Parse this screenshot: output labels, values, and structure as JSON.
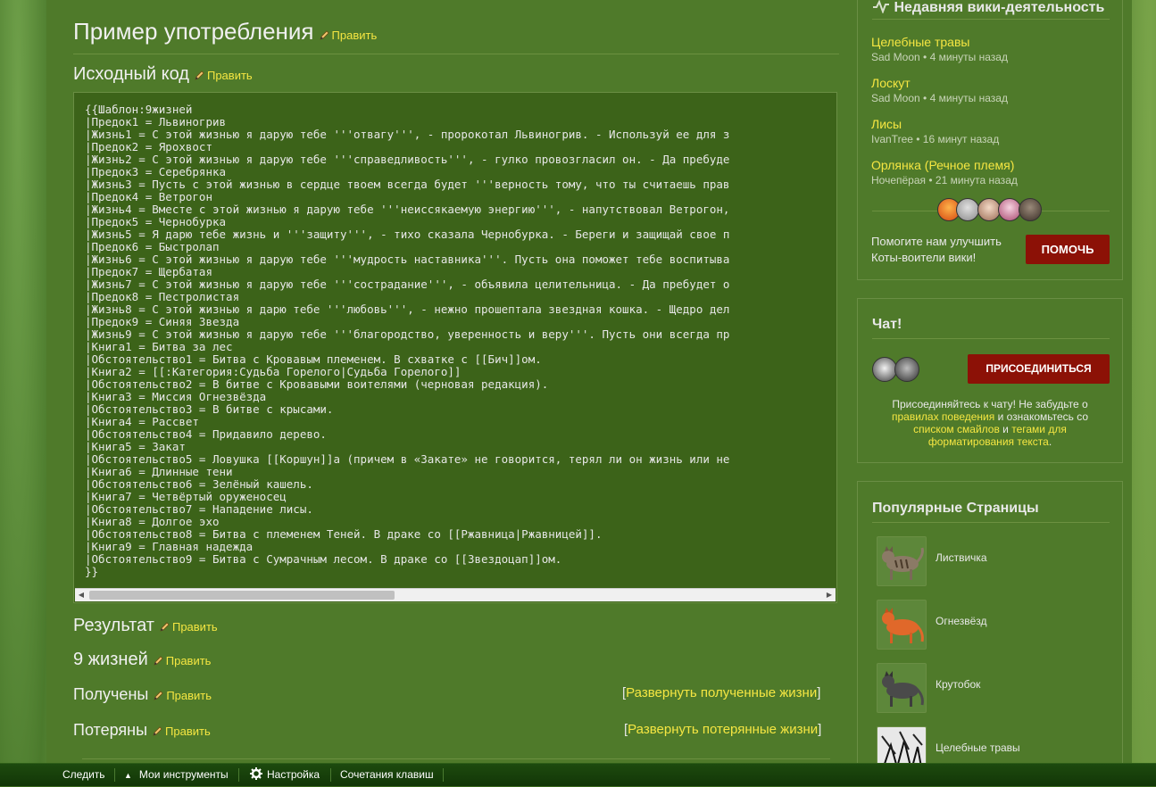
{
  "edit_label": "Править",
  "sections": {
    "usage_heading": "Пример употребления",
    "source_heading": "Исходный код",
    "result_heading": "Результат",
    "lives_heading": "9 жизней",
    "received_heading": "Получены",
    "lost_heading": "Потеряны"
  },
  "expand": {
    "received": "Развернуть полученные жизни",
    "lost": "Развернуть потерянные жизни",
    "bracket_open": "[",
    "bracket_close": "]"
  },
  "code_lines": [
    "{{Шаблон:9жизней",
    "|Предок1 = Львиногрив",
    "|Жизнь1 = С этой жизнью я дарую тебе '''отвагу''', - пророкотал Львиногрив. - Используй ее для з",
    "|Предок2 = Ярохвост",
    "|Жизнь2 = С этой жизнью я дарую тебе '''справедливость''', - гулко провозгласил он. - Да пребуде",
    "|Предок3 = Серебрянка",
    "|Жизнь3 = Пусть с этой жизнью в сердце твоем всегда будет '''верность тому, что ты считаешь прав",
    "|Предок4 = Ветрогон",
    "|Жизнь4 = Вместе с этой жизнью я дарую тебе '''неиссякаемую энергию''', - напутствовал Ветрогон,",
    "|Предок5 = Чернобурка",
    "|Жизнь5 = Я дарю тебе жизнь и '''защиту''', - тихо сказала Чернобурка. - Береги и защищай свое п",
    "|Предок6 = Быстролап",
    "|Жизнь6 = С этой жизнью я дарую тебе '''мудрость наставника'''. Пусть она поможет тебе воспитыва",
    "|Предок7 = Щербатая",
    "|Жизнь7 = С этой жизнью я дарую тебе '''сострадание''', - объявила целительница. - Да пребудет о",
    "|Предок8 = Пестролистая",
    "|Жизнь8 = С этой жизнью я дарю тебе '''любовь''', - нежно прошептала звездная кошка. - Щедро дел",
    "|Предок9 = Синяя Звезда",
    "|Жизнь9 = С этой жизнью я дарую тебе '''благородство, уверенность и веру'''. Пусть они всегда пр",
    "|Книга1 = Битва за лес",
    "|Обстоятельство1 = Битва с Кровавым племенем. В схватке с [[Бич]]ом.",
    "|Книга2 = [[:Категория:Судьба Горелого|Судьба Горелого]]",
    "|Обстоятельство2 = В битве с Кровавыми воителями (черновая редакция).",
    "|Книга3 = Миссия Огнезвёзда",
    "|Обстоятельство3 = В битве с крысами.",
    "|Книга4 = Рассвет",
    "|Обстоятельство4 = Придавило дерево.",
    "|Книга5 = Закат",
    "|Обстоятельство5 = Ловушка [[Коршун]]а (причем в «Закате» не говорится, терял ли он жизнь или не",
    "|Книга6 = Длинные тени",
    "|Обстоятельство6 = Зелёный кашель.",
    "|Книга7 = Четвёртый оруженосец",
    "|Обстоятельство7 = Нападение лисы.",
    "|Книга8 = Долгое эхо",
    "|Обстоятельство8 = Битва с племенем Теней. В драке со [[Ржавница|Ржавницей]].",
    "|Книга9 = Главная надежда",
    "|Обстоятельство9 = Битва с Сумрачным лесом. В драке со [[Звездоцап]]ом.",
    "}}"
  ],
  "activity": {
    "title": "Недавняя вики-деятельность",
    "items": [
      {
        "page": "Целебные травы",
        "meta": "Sad Moon • 4 минуты назад"
      },
      {
        "page": "Лоскут",
        "meta": "Sad Moon • 4 минуты назад"
      },
      {
        "page": "Лисы",
        "meta": "IvanTree • 16 минут назад"
      },
      {
        "page": "Орлянка (Речное племя)",
        "meta": "Ночепёрая • 21 минута назад"
      }
    ],
    "help_text": "Помогите нам улучшить Коты-воители вики!",
    "help_button": "ПОМОЧЬ"
  },
  "chat": {
    "title": "Чат!",
    "join_button": "ПРИСОЕДИНИТЬСЯ",
    "desc_1": "Присоединяйтесь к чату! Не забудьте о ",
    "link_rules": "правилах поведения",
    "desc_2": " и ознакомьтесь со ",
    "link_smileys": "списком смайлов",
    "desc_3": " и ",
    "link_tags": "тегами для форматирования текста",
    "desc_4": "."
  },
  "popular": {
    "title": "Популярные Страницы",
    "items": [
      "Листвичка",
      "Огнезвёзд",
      "Крутобок",
      "Целебные травы"
    ]
  },
  "toolbar": {
    "follow": "Следить",
    "my_tools": "Мои инструменты",
    "settings": "Настройка",
    "shortcuts": "Сочетания клавиш"
  },
  "colors": {
    "link": "#f5e642",
    "button": "#8c1106",
    "content_bg": "#4f7a2a",
    "code_bg": "#3c6319"
  },
  "icons": [
    "pencil-icon",
    "activity-pulse-icon",
    "gear-icon",
    "caret-up-icon",
    "arrow-left-icon",
    "arrow-right-icon"
  ]
}
